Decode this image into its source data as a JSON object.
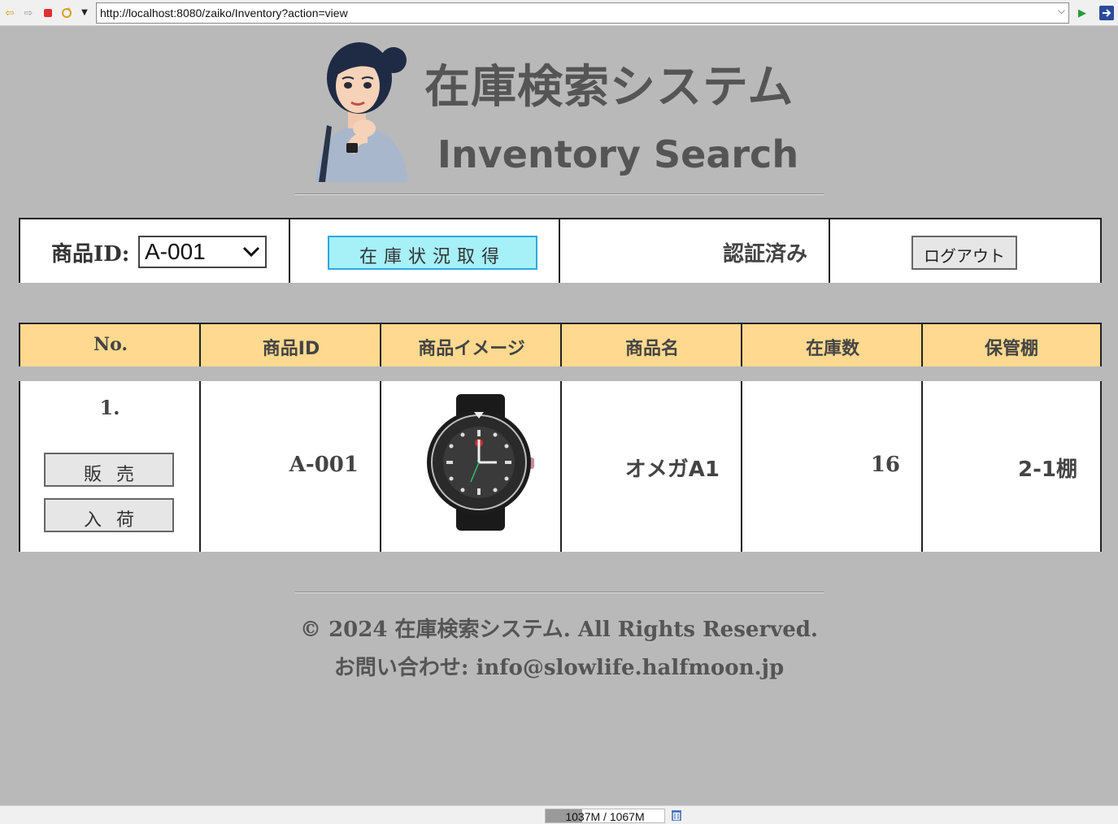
{
  "browser": {
    "url": "http://localhost:8080/zaiko/Inventory?action=view",
    "memory": {
      "used_label": "1037M / 1067M",
      "used_fraction": 0.972
    }
  },
  "header": {
    "title_jp": "在庫検索システム",
    "title_en": "Inventory Search"
  },
  "controls": {
    "product_id_label": "商品ID:",
    "product_id_selected": "A-001",
    "get_status_button": "在庫状況取得",
    "auth_status": "認証済み",
    "logout_button": "ログアウト"
  },
  "table": {
    "headers": [
      "No.",
      "商品ID",
      "商品イメージ",
      "商品名",
      "在庫数",
      "保管棚"
    ],
    "rows": [
      {
        "no": "1.",
        "product_id": "A-001",
        "product_name": "オメガA1",
        "stock": "16",
        "shelf": "2-1棚",
        "sell_button": "販売",
        "receive_button": "入荷"
      }
    ]
  },
  "footer": {
    "copyright_prefix": "© 2024 ",
    "copyright_jp": "在庫検索システム",
    "copyright_suffix": ". All Rights Reserved.",
    "contact_label": "お問い合わせ",
    "contact_sep": ": ",
    "contact_email": "info@slowlife.halfmoon.jp"
  },
  "colors": {
    "page_bg": "#b9b9b9",
    "header_cell_bg": "#ffd98f",
    "primary_button_bg": "#a6f0f8",
    "primary_button_border": "#2ea8e0"
  }
}
